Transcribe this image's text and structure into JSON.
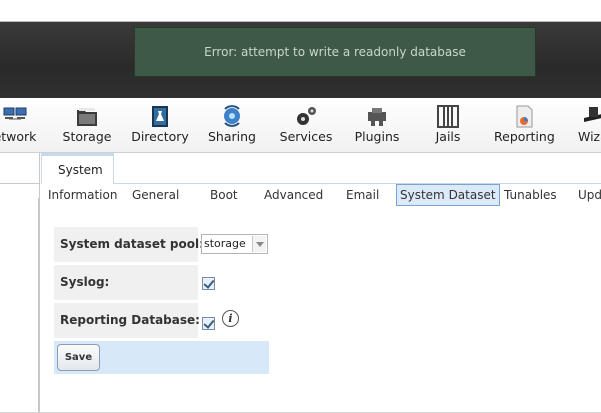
{
  "error_message": "Error: attempt to write a readonly database",
  "toolbar": [
    {
      "label": "etwork",
      "icon": "network-icon"
    },
    {
      "label": "Storage",
      "icon": "storage-icon"
    },
    {
      "label": "Directory",
      "icon": "directory-icon"
    },
    {
      "label": "Sharing",
      "icon": "sharing-icon"
    },
    {
      "label": "Services",
      "icon": "services-icon"
    },
    {
      "label": "Plugins",
      "icon": "plugins-icon"
    },
    {
      "label": "Jails",
      "icon": "jails-icon"
    },
    {
      "label": "Reporting",
      "icon": "reporting-icon"
    },
    {
      "label": "Wiza",
      "icon": "wizard-icon"
    }
  ],
  "main_tab": "System",
  "subtabs": [
    "Information",
    "General",
    "Boot",
    "Advanced",
    "Email",
    "System Dataset",
    "Tunables",
    "Upd"
  ],
  "active_subtab": "System Dataset",
  "form": {
    "pool_label": "System dataset pool:",
    "pool_value": "storage",
    "syslog_label": "Syslog:",
    "syslog_checked": true,
    "reporting_label": "Reporting Database:",
    "reporting_checked": true,
    "save_label": "Save"
  }
}
